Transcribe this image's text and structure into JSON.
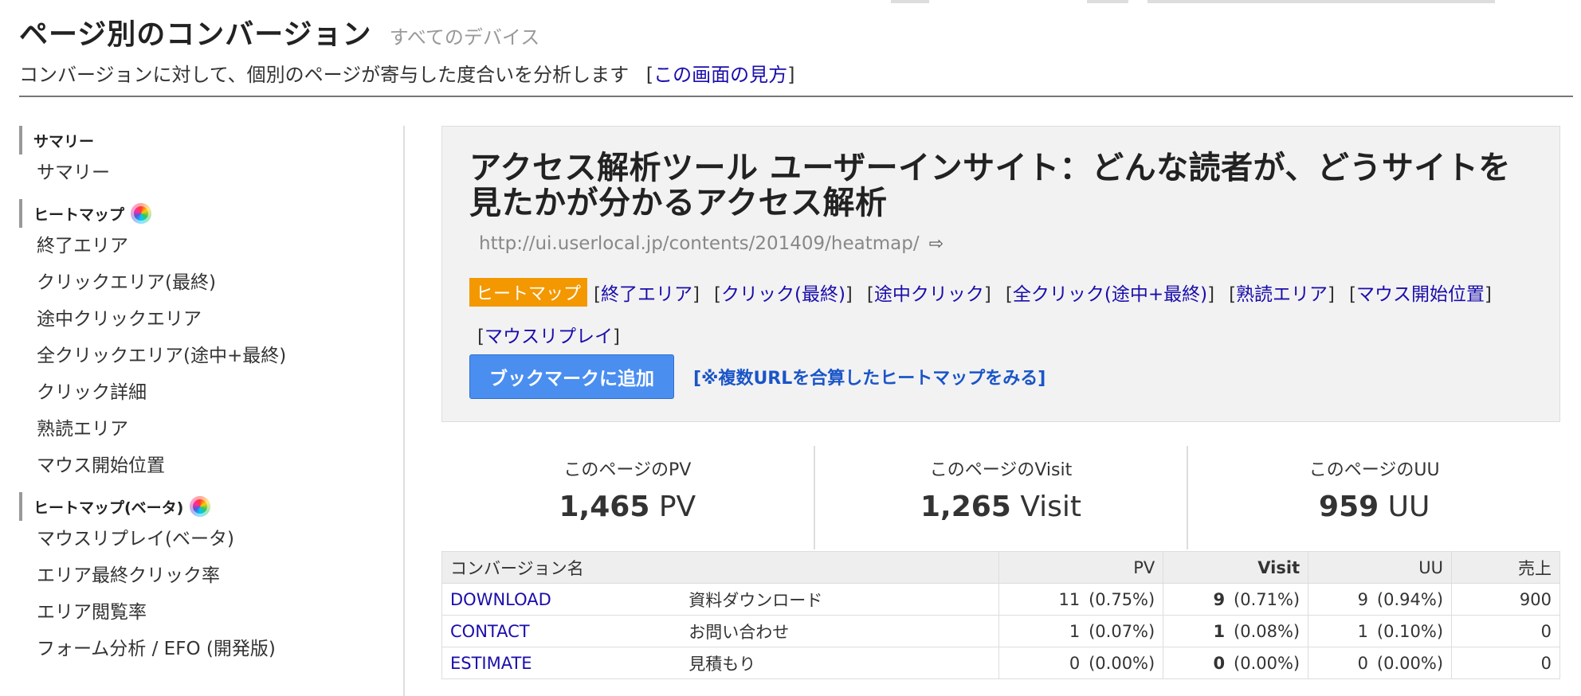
{
  "header": {
    "title": "ページ別のコンバージョン",
    "device": "すべてのデバイス",
    "description": "コンバージョンに対して、個別のページが寄与した度合いを分析します",
    "help_link": "この画面の見方"
  },
  "sidebar": {
    "sections": [
      {
        "title": "サマリー",
        "items": [
          "サマリー"
        ]
      },
      {
        "title": "ヒートマップ",
        "items": [
          "終了エリア",
          "クリックエリア(最終)",
          "途中クリックエリア",
          "全クリックエリア(途中+最終)",
          "クリック詳細",
          "熟読エリア",
          "マウス開始位置"
        ]
      },
      {
        "title": "ヒートマップ(ベータ)",
        "items": [
          "マウスリプレイ(ベータ)",
          "エリア最終クリック率",
          "エリア閲覧率",
          "フォーム分析 / EFO (開発版)"
        ]
      }
    ]
  },
  "page": {
    "title": "アクセス解析ツール ユーザーインサイト：どんな読者が、どうサイトを見たかが分かるアクセス解析",
    "url": "http://ui.userlocal.jp/contents/201409/heatmap/",
    "active_tab": "ヒートマップ",
    "tabs": [
      "終了エリア",
      "クリック(最終)",
      "途中クリック",
      "全クリック(途中+最終)",
      "熟読エリア",
      "マウス開始位置",
      "マウスリプレイ"
    ],
    "bookmark_button": "ブックマークに追加",
    "multi_url_link": "[※複数URLを合算したヒートマップをみる]"
  },
  "stats": [
    {
      "label": "このページのPV",
      "value": "1,465",
      "unit": "PV"
    },
    {
      "label": "このページのVisit",
      "value": "1,265",
      "unit": "Visit"
    },
    {
      "label": "このページのUU",
      "value": "959",
      "unit": "UU"
    }
  ],
  "table": {
    "headers": {
      "name": "コンバージョン名",
      "pv": "PV",
      "visit": "Visit",
      "uu": "UU",
      "sales": "売上"
    },
    "rows": [
      {
        "id": "DOWNLOAD",
        "desc": "資料ダウンロード",
        "pv": "11",
        "pv_pct": "(0.75%)",
        "visit": "9",
        "visit_pct": "(0.71%)",
        "uu": "9",
        "uu_pct": "(0.94%)",
        "sales": "900"
      },
      {
        "id": "CONTACT",
        "desc": "お問い合わせ",
        "pv": "1",
        "pv_pct": "(0.07%)",
        "visit": "1",
        "visit_pct": "(0.08%)",
        "uu": "1",
        "uu_pct": "(0.10%)",
        "sales": "0"
      },
      {
        "id": "ESTIMATE",
        "desc": "見積もり",
        "pv": "0",
        "pv_pct": "(0.00%)",
        "visit": "0",
        "visit_pct": "(0.00%)",
        "uu": "0",
        "uu_pct": "(0.00%)",
        "sales": "0"
      }
    ]
  }
}
